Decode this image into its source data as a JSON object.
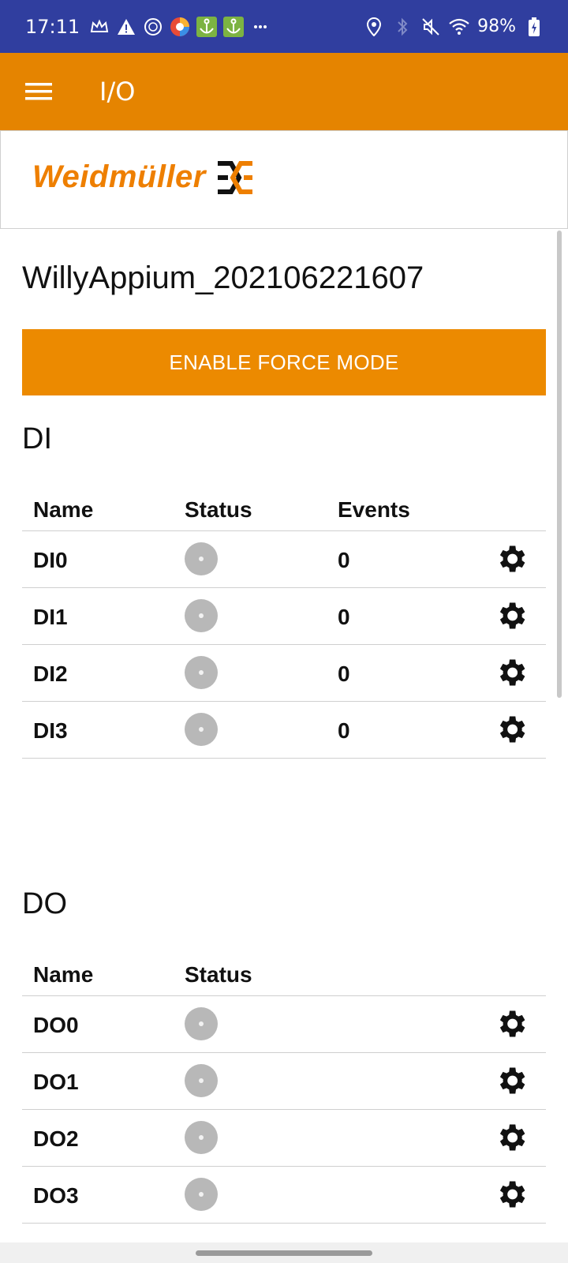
{
  "status_bar": {
    "time": "17:11",
    "battery_text": "98%",
    "icons_left": [
      "crown-icon",
      "warning-icon",
      "vpn-icon",
      "browser-icon",
      "anchor-icon",
      "anchor-icon",
      "more-icon"
    ],
    "icons_right": [
      "location-icon",
      "bluetooth-icon",
      "mute-icon",
      "wifi-icon",
      "battery-icon"
    ],
    "colors": {
      "background": "#303e9f"
    }
  },
  "app_bar": {
    "title": "I/O",
    "menu_icon": "hamburger-menu-icon",
    "colors": {
      "background": "#e58400"
    }
  },
  "brand": {
    "wordmark": "Weidmüller",
    "mark_icon": "weidmuller-logo-icon",
    "colors": {
      "text": "#ee7f00"
    }
  },
  "device": {
    "name": "WillyAppium_202106221607"
  },
  "force_button": {
    "label": "ENABLE FORCE MODE",
    "colors": {
      "background": "#ec8a00"
    }
  },
  "di": {
    "title": "DI",
    "headers": {
      "name": "Name",
      "status": "Status",
      "events": "Events"
    },
    "rows": [
      {
        "name": "DI0",
        "events": "0",
        "status": "off"
      },
      {
        "name": "DI1",
        "events": "0",
        "status": "off"
      },
      {
        "name": "DI2",
        "events": "0",
        "status": "off"
      },
      {
        "name": "DI3",
        "events": "0",
        "status": "off"
      }
    ]
  },
  "do": {
    "title": "DO",
    "headers": {
      "name": "Name",
      "status": "Status"
    },
    "rows": [
      {
        "name": "DO0",
        "status": "off"
      },
      {
        "name": "DO1",
        "status": "off"
      },
      {
        "name": "DO2",
        "status": "off"
      },
      {
        "name": "DO3",
        "status": "off"
      }
    ]
  }
}
